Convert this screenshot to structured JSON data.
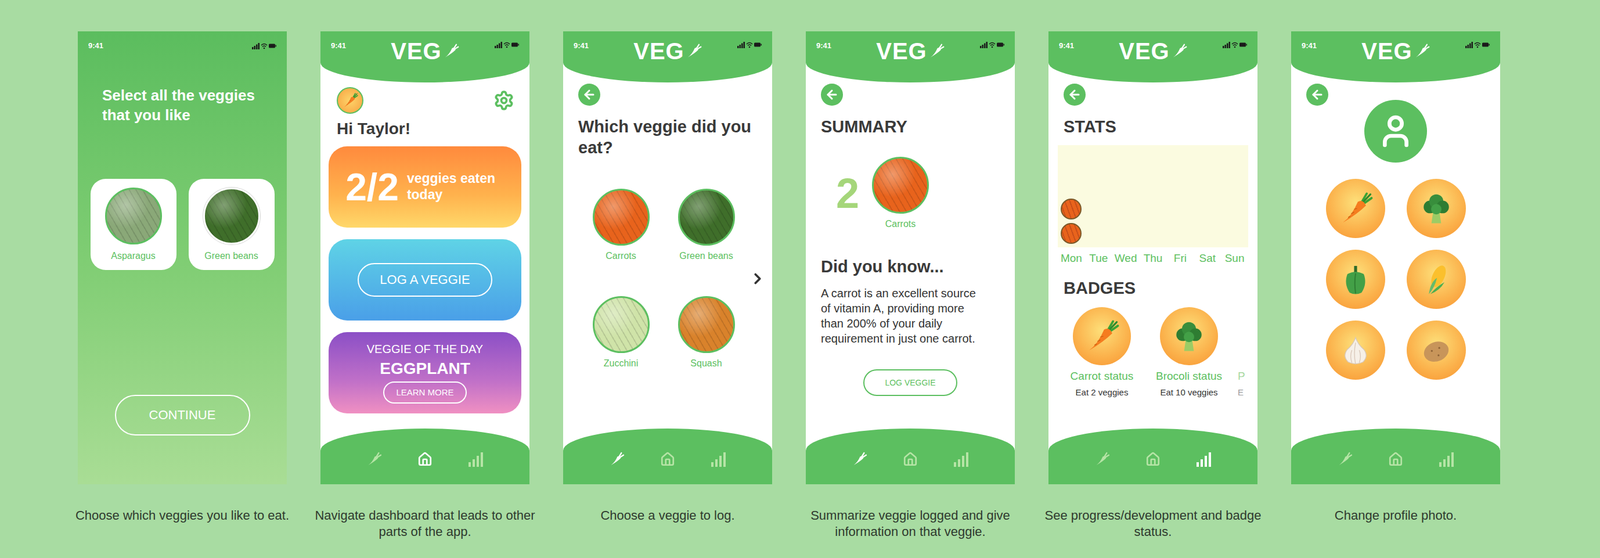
{
  "screens": [
    {
      "kind": "onboarding",
      "time": "9:41",
      "title": "Select all the veggies that you like",
      "options": [
        {
          "label": "Asparagus",
          "selected": true,
          "color": "#8aa878"
        },
        {
          "label": "Green beans",
          "selected": false,
          "color": "#3f6e2a"
        }
      ],
      "button": "CONTINUE",
      "caption": "Choose which veggies you like to eat."
    },
    {
      "kind": "dashboard",
      "time": "9:41",
      "logo": "VEG",
      "greeting": "Hi Taylor!",
      "progress": {
        "count": "2/2",
        "label": "veggies eaten today"
      },
      "log_button": "LOG A VEGGIE",
      "veggie_of_day": {
        "heading": "VEGGIE OF THE DAY",
        "name": "EGGPLANT",
        "button": "LEARN MORE"
      },
      "nav": [
        {
          "kind": "log",
          "selected": false
        },
        {
          "kind": "home",
          "selected": true
        },
        {
          "kind": "stats",
          "selected": false
        }
      ],
      "caption": "Navigate dashboard that leads to other parts of the app."
    },
    {
      "kind": "choose",
      "time": "9:41",
      "logo": "VEG",
      "title": "Which veggie did you eat?",
      "veggies": [
        {
          "label": "Carrots",
          "color": "#e8631c"
        },
        {
          "label": "Green beans",
          "color": "#3f6e2a"
        },
        {
          "label": "Zucchini",
          "color": "#cfe3a8"
        },
        {
          "label": "Squash",
          "color": "#d9822b"
        }
      ],
      "nav": [
        {
          "kind": "log",
          "selected": true
        },
        {
          "kind": "home",
          "selected": false
        },
        {
          "kind": "stats",
          "selected": false
        }
      ],
      "caption": "Choose a veggie to log."
    },
    {
      "kind": "summary",
      "time": "9:41",
      "logo": "VEG",
      "title": "SUMMARY",
      "count": "2",
      "veggie": {
        "label": "Carrots",
        "color": "#e8631c"
      },
      "fact_title": "Did you know...",
      "fact": "A carrot is an excellent source of vitamin A, providing more than 200% of your daily requirement in just one carrot.",
      "button": "LOG VEGGIE",
      "nav": [
        {
          "kind": "log",
          "selected": true
        },
        {
          "kind": "home",
          "selected": false
        },
        {
          "kind": "stats",
          "selected": false
        }
      ],
      "caption": "Summarize veggie logged and give information on that veggie."
    },
    {
      "kind": "stats",
      "time": "9:41",
      "logo": "VEG",
      "title": "STATS",
      "chart": {
        "days": [
          "Mon",
          "Tue",
          "Wed",
          "Thu",
          "Fri",
          "Sat",
          "Sun"
        ],
        "values": [
          2,
          0,
          0,
          0,
          0,
          0,
          0
        ]
      },
      "badges_title": "BADGES",
      "badges": [
        {
          "kind": "carrot",
          "label": "Carrot status",
          "requirement": "Eat 2 veggies",
          "cut": false
        },
        {
          "kind": "broccoli",
          "label": "Brocoli status",
          "requirement": "Eat 10 veggies",
          "cut": false
        },
        {
          "kind": "none",
          "label": "P",
          "requirement": "E",
          "cut": true
        }
      ],
      "nav": [
        {
          "kind": "log",
          "selected": false
        },
        {
          "kind": "home",
          "selected": false
        },
        {
          "kind": "stats",
          "selected": true
        }
      ],
      "caption": "See progress/development and badge status."
    },
    {
      "kind": "profile",
      "time": "9:41",
      "logo": "VEG",
      "options": [
        {
          "kind": "carrot",
          "selected": false
        },
        {
          "kind": "broccoli",
          "selected": false
        },
        {
          "kind": "pepper",
          "selected": false
        },
        {
          "kind": "corn",
          "selected": false
        },
        {
          "kind": "garlic",
          "selected": false
        },
        {
          "kind": "potato",
          "selected": false
        }
      ],
      "nav": [
        {
          "kind": "log",
          "selected": false
        },
        {
          "kind": "home",
          "selected": false
        },
        {
          "kind": "stats",
          "selected": false
        }
      ],
      "caption": "Change profile photo."
    }
  ]
}
